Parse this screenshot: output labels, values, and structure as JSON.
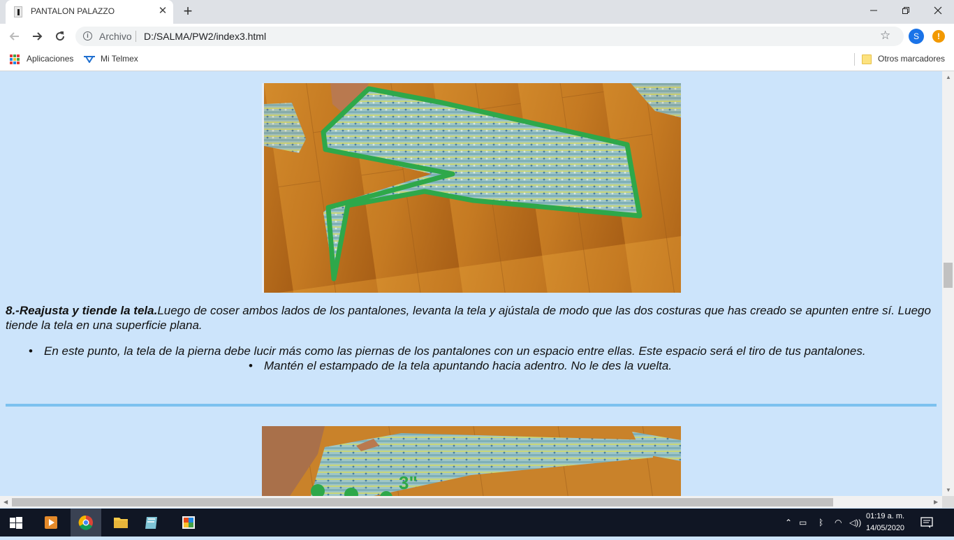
{
  "browser": {
    "tab": {
      "title": "PANTALON PALAZZO"
    },
    "address": {
      "scheme_label": "Archivo",
      "url": "D:/SALMA/PW2/index3.html"
    },
    "profile_initial": "S",
    "alert_glyph": "!",
    "bookmarks": {
      "apps": "Aplicaciones",
      "telmex": "Mi Telmex",
      "other": "Otros marcadores"
    }
  },
  "content": {
    "step": {
      "heading": "8.-Reajusta y tiende la tela.",
      "body": "Luego de coser ambos lados de los pantalones, levanta la tela y ajústala de modo que las dos costuras que has creado se apunten entre sí. Luego tiende la tela en una superficie plana."
    },
    "bullets": [
      "En este punto, la tela de la pierna debe lucir más como las piernas de los pantalones con un espacio entre ellas. Este espacio será el tiro de tus pantalones.",
      "Mantén el estampado de la tela apuntando hacia adentro. No le des la vuelta."
    ],
    "photo2_overlay": "3\""
  },
  "taskbar": {
    "time": "01:19 a. m.",
    "date": "14/05/2020"
  },
  "colors": {
    "page_background": "#cce4fb",
    "divider": "#7cc1ef",
    "outline_green": "#2ea84a",
    "floor_wood": "#c9822a"
  }
}
